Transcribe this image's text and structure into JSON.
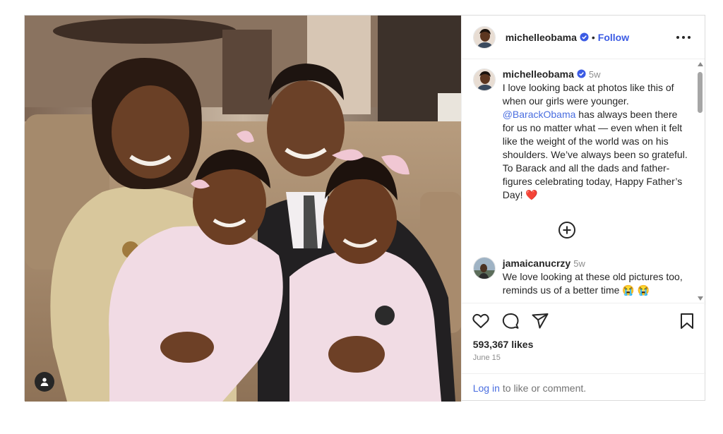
{
  "post": {
    "username": "michelleobama",
    "follow_label": "Follow",
    "separator": "•"
  },
  "caption": {
    "username": "michelleobama",
    "time": "5w",
    "text_before": "I love looking back at photos like this of when our girls were younger. ",
    "mention": "@BarackObama",
    "text_after": " has always been there for us no matter what — even when it felt like the weight of the world was on his shoulders. We’ve always been so grateful. To Barack and all the dads and father-figures celebrating today, Happy Father’s Day! ",
    "emoji": "❤️"
  },
  "comment": {
    "username": "jamaicanucrzy",
    "time": "5w",
    "text": "We love looking at these old pictures too, reminds us of a better time ",
    "emoji": "😭 😭"
  },
  "stats": {
    "likes": "593,367 likes",
    "date": "June 15"
  },
  "login": {
    "link_label": "Log in",
    "suffix": "to like or comment."
  },
  "icons": {
    "tag": "user-tag-icon",
    "more": "more-options-icon",
    "like": "heart-icon",
    "comment": "comment-icon",
    "share": "share-icon",
    "save": "bookmark-icon",
    "load_more": "plus-circle-icon",
    "verified": "verified-badge-icon"
  },
  "colors": {
    "link": "#4a6ee0",
    "verified": "#3b5be4",
    "heart_emoji": "#e8446b"
  }
}
